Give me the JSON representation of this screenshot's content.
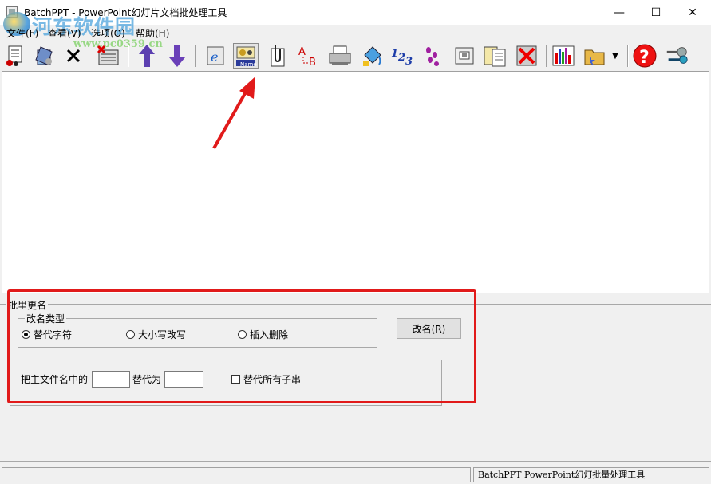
{
  "window": {
    "title": "BatchPPT - PowerPoint幻灯片文档批处理工具",
    "minimize_glyph": "—",
    "maximize_glyph": "☐",
    "close_glyph": "✕"
  },
  "watermark": {
    "text": "河东软件园",
    "url": "www.pc0359.cn"
  },
  "menu": [
    {
      "label": "文件(F)"
    },
    {
      "label": "查看(V)"
    },
    {
      "label": "选项(O)"
    },
    {
      "label": "帮助(H)"
    }
  ],
  "toolbar": {
    "rename_badge": "Name",
    "numbers_text": "123",
    "dropdown_glyph": "▼",
    "help_glyph": "?"
  },
  "rename_panel": {
    "title": "批里更名",
    "type_group_label": "改名类型",
    "options": [
      {
        "label": "替代字符",
        "selected": true
      },
      {
        "label": "大小写改写",
        "selected": false
      },
      {
        "label": "插入删除",
        "selected": false
      }
    ],
    "rename_button": "改名(R)",
    "replace_label": "把主文件名中的",
    "replace_with_label": "替代为",
    "find_value": "",
    "replace_value": "",
    "replace_all_label": "替代所有子串",
    "replace_all_checked": false
  },
  "status": {
    "left": "",
    "right": "BatchPPT PowerPoint幻灯批量处理工具"
  },
  "colors": {
    "annotation": "#e11a1a",
    "arrow_up": "#5b3fb0",
    "arrow_down": "#6a40b8"
  }
}
